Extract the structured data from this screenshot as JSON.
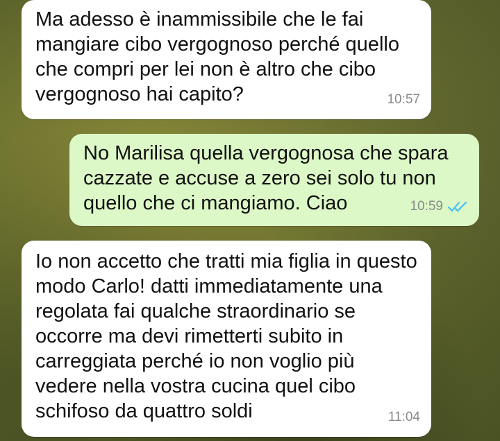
{
  "chat": {
    "messages": [
      {
        "direction": "incoming",
        "text": "Ma adesso è inammissibile che le fai mangiare cibo vergognoso perché quello che compri per lei non è altro che cibo vergognoso hai capito?",
        "time": "10:57"
      },
      {
        "direction": "outgoing",
        "text": "No Marilisa quella vergognosa che spara cazzate e accuse a zero sei solo tu non quello che ci mangiamo. Ciao",
        "time": "10:59",
        "status": "read",
        "status_icon": "double-check-icon"
      },
      {
        "direction": "incoming",
        "text": "Io non accetto che tratti mia figlia in questo modo Carlo! datti immediatamente una regolata fai qualche straordinario se occorre ma devi rimetterti subito in carreggiata perché io non voglio più vedere nella vostra cucina quel cibo schifoso da quattro soldi",
        "time": "11:04"
      }
    ]
  },
  "colors": {
    "incoming_bubble": "#ffffff",
    "outgoing_bubble": "#dcf8c6",
    "read_ticks": "#4fc3f7",
    "timestamp": "#8a8a8a"
  }
}
